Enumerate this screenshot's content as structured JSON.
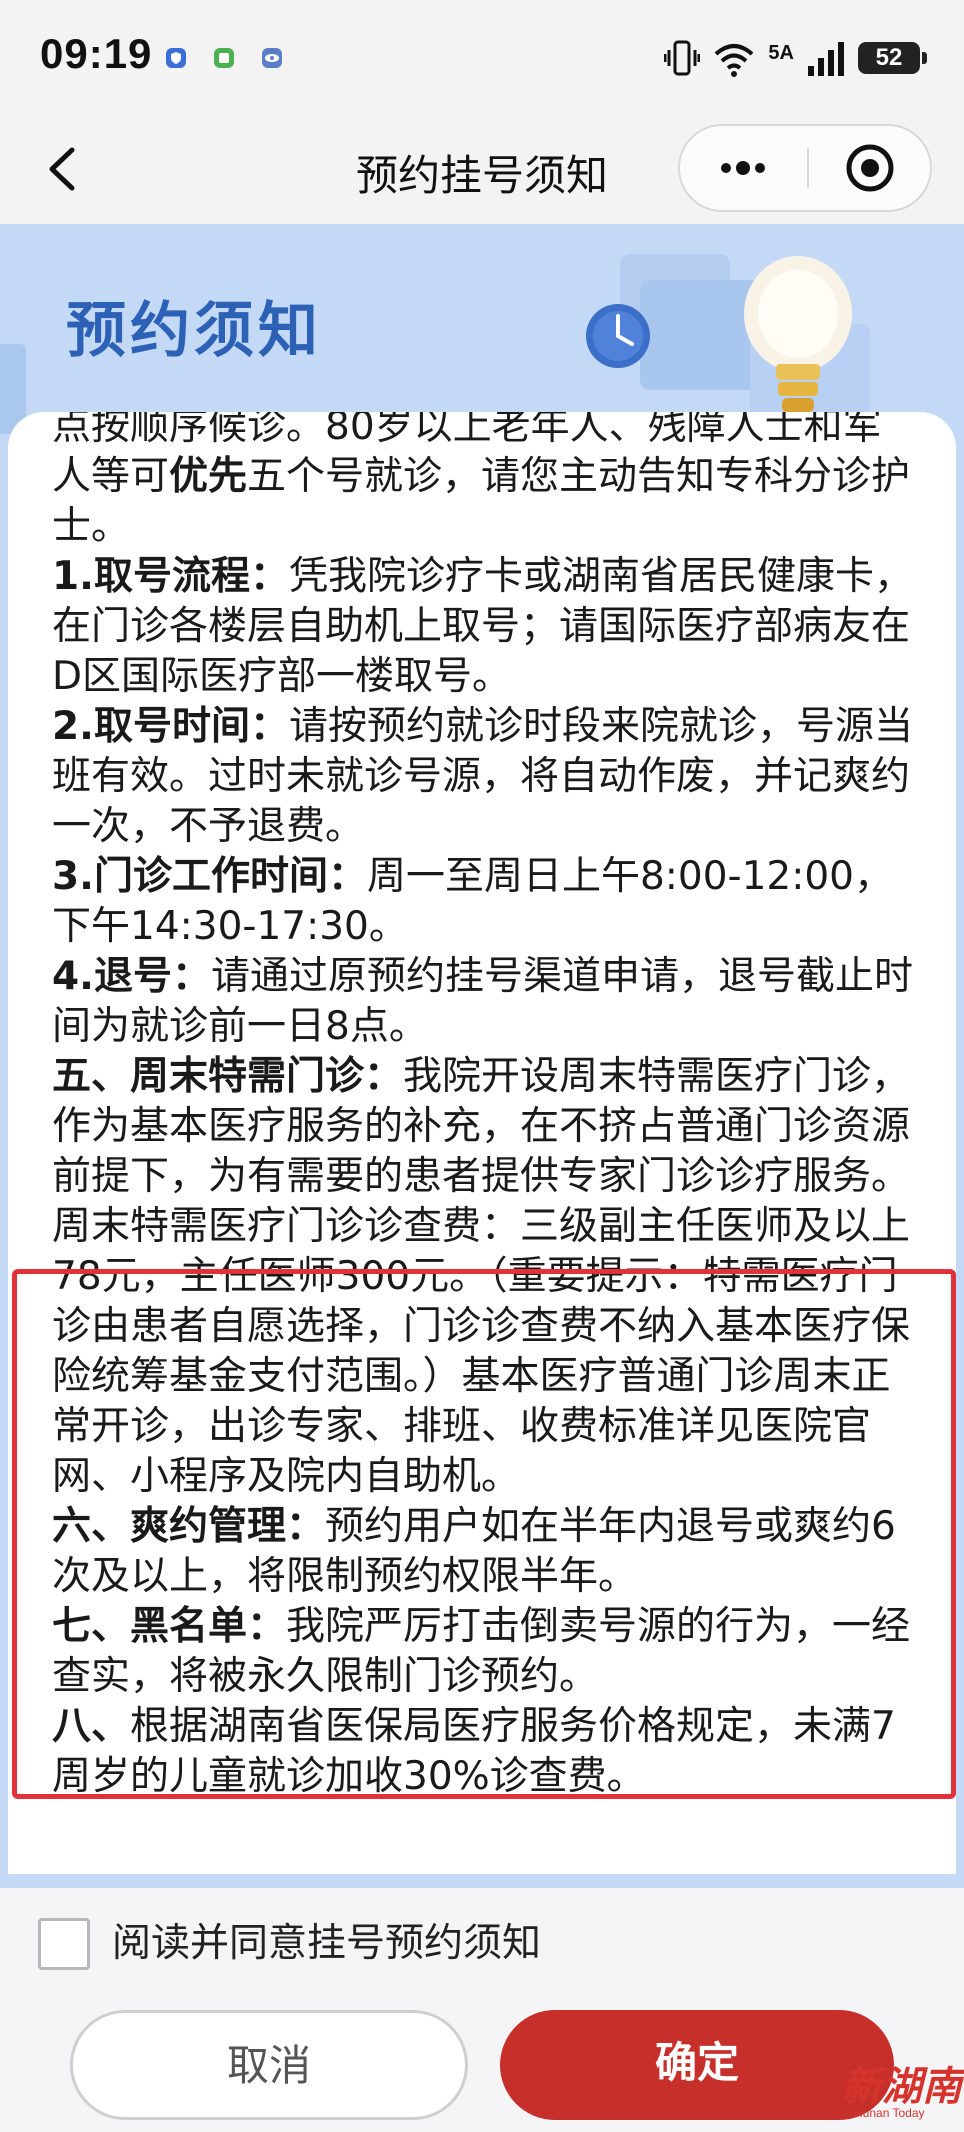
{
  "status_bar": {
    "time": "09:19",
    "network": "5A",
    "battery": "52"
  },
  "nav": {
    "title": "预约挂号须知"
  },
  "banner": {
    "title": "预约须知"
  },
  "notice": {
    "p0": [
      {
        "text": "点按顺序候诊。80岁以上老年人、残障人士和军人等可"
      },
      {
        "text": "优先",
        "bold": true
      },
      {
        "text": "五个号就诊，请您主动告知专科分诊护士。"
      }
    ],
    "p1": [
      {
        "text": "1.取号流程：",
        "bold": true
      },
      {
        "text": "凭我院诊疗卡或湖南省居民健康卡，在门诊各楼层自助机上取号；请国际医疗部病友在D区国际医疗部一楼取号。"
      }
    ],
    "p2": [
      {
        "text": "2.取号时间：",
        "bold": true
      },
      {
        "text": "请按预约就诊时段来院就诊，号源当班有效。过时未就诊号源，将自动作废，并记爽约一次，不予退费。"
      }
    ],
    "p3": [
      {
        "text": "3.门诊工作时间：",
        "bold": true
      },
      {
        "text": "周一至周日上午8:00-12:00，下午14:30-17:30。"
      }
    ],
    "p4": [
      {
        "text": "4.退号：",
        "bold": true
      },
      {
        "text": "请通过原预约挂号渠道申请，退号截止时间为就诊前一日8点。"
      }
    ],
    "p5": [
      {
        "text": "五、周末特需门诊：",
        "bold": true
      },
      {
        "text": "我院开设周末特需医疗门诊，作为基本医疗服务的补充，在不挤占普通门诊资源前提下，为有需要的患者提供专家门诊诊疗服务。周末特需医疗门诊诊查费：三级副主任医师及以上78元，主任医师300元。（重要提示：特需医疗门诊由患者自愿选择，门诊诊查费不纳入基本医疗保险统筹基金支付范围。）基本医疗普通门诊周末正常开诊，出诊专家、排班、收费标准详见医院官网、小程序及院内自助机。"
      }
    ],
    "p6": [
      {
        "text": "六、爽约管理：",
        "bold": true
      },
      {
        "text": "预约用户如在半年内退号或爽约6次及以上，将限制预约权限半年。"
      }
    ],
    "p7": [
      {
        "text": "七、黑名单：",
        "bold": true
      },
      {
        "text": "我院严厉打击倒卖号源的行为，一经查实，将被永久限制门诊预约。"
      }
    ],
    "p8": [
      {
        "text": "八、",
        "bold": true
      },
      {
        "text": "根据湖南省医保局医疗服务价格规定，未满7周岁的儿童就诊加收30%诊查费。"
      }
    ]
  },
  "footer": {
    "agree_label": "阅读并同意挂号预约须知",
    "agree_checked": false,
    "cancel_label": "取消",
    "confirm_label": "确定"
  },
  "colors": {
    "brand_blue": "#2d61b5",
    "banner_bg": "#c3d9f5",
    "confirm_red": "#c62f2a",
    "highlight_red": "#e03238"
  },
  "watermark": {
    "logo_text": "新湖南",
    "sub_text": "Hunan Today"
  }
}
